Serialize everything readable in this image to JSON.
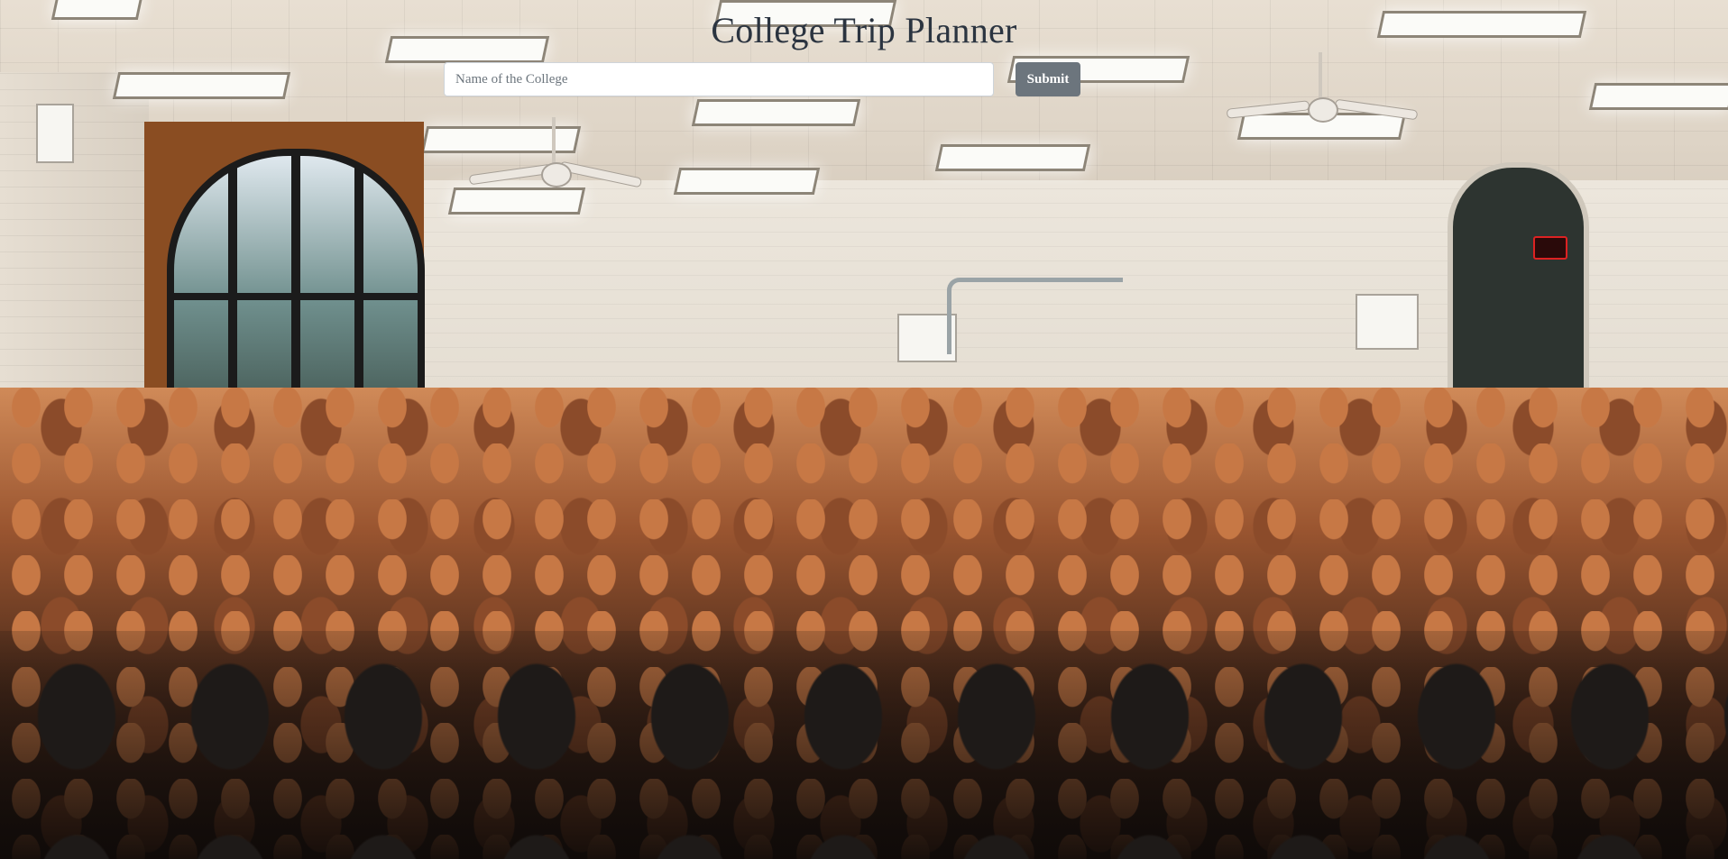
{
  "page": {
    "title": "College Trip Planner",
    "background_image": "lecture-hall-photo"
  },
  "search": {
    "placeholder": "Name of the College",
    "value": "",
    "submit_label": "Submit"
  },
  "colors": {
    "title_text": "#2b3440",
    "submit_bg": "#6c757d",
    "submit_text": "#ffffff",
    "input_bg": "#ffffff"
  }
}
